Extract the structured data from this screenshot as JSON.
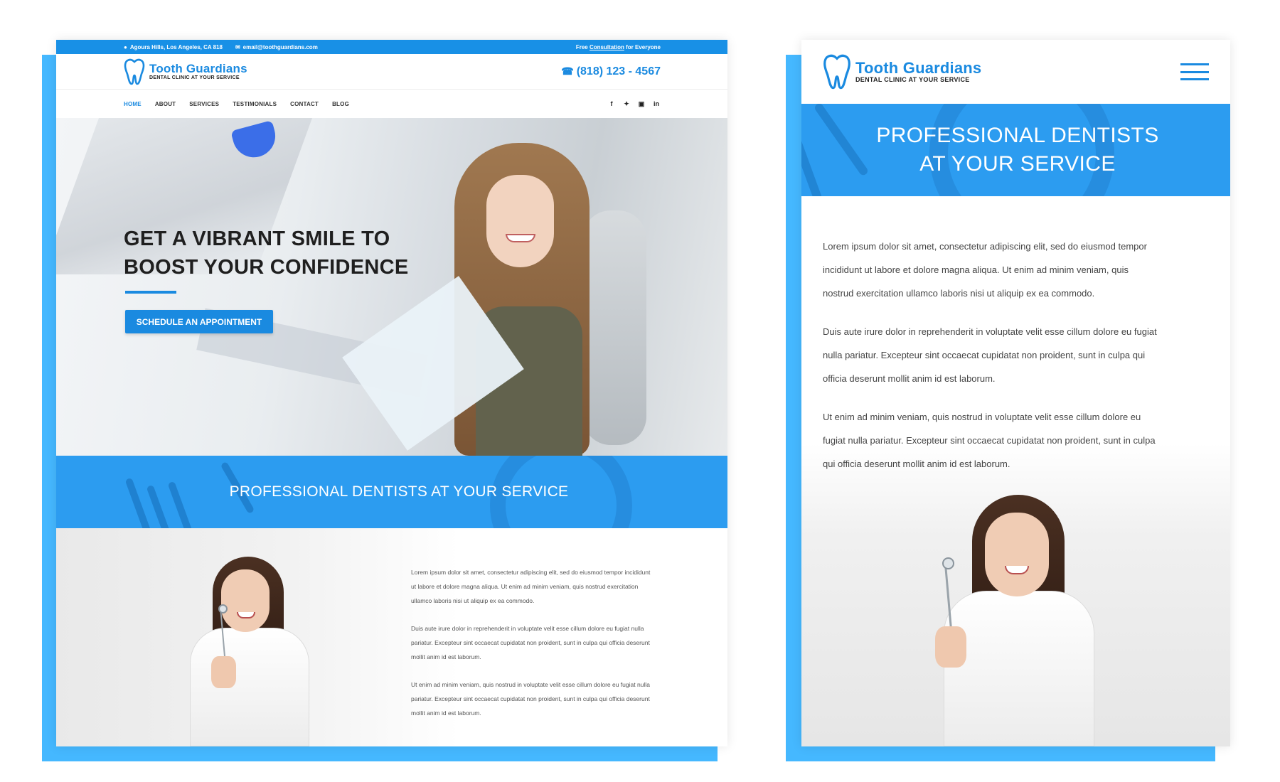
{
  "brand": {
    "name": "Tooth Guardians",
    "tagline": "DENTAL CLINIC AT YOUR SERVICE",
    "accent": "#1a8ae0",
    "frame_color": "#45b8ff"
  },
  "desktop": {
    "topbar": {
      "location_icon": "map-pin-icon",
      "location": "Agoura Hills, Los Angeles, CA 818",
      "email_icon": "envelope-icon",
      "email": "email@toothguardians.com",
      "right_prefix": "Free",
      "right_link": "Consultation",
      "right_suffix": "for Everyone"
    },
    "phone": "(818) 123 - 4567",
    "nav": [
      "HOME",
      "ABOUT",
      "SERVICES",
      "TESTIMONIALS",
      "CONTACT",
      "BLOG"
    ],
    "social": [
      "facebook-icon",
      "twitter-icon",
      "instagram-icon",
      "linkedin-icon"
    ],
    "hero": {
      "title_line1": "GET A VIBRANT SMILE TO",
      "title_line2": "BOOST YOUR CONFIDENCE",
      "button": "SCHEDULE AN APPOINTMENT"
    },
    "band_title": "PROFESSIONAL DENTISTS AT YOUR SERVICE",
    "paragraphs": [
      "Lorem ipsum dolor sit amet, consectetur adipiscing elit, sed do eiusmod tempor incididunt ut labore et dolore magna aliqua. Ut enim ad minim veniam, quis nostrud exercitation ullamco laboris nisi ut aliquip ex ea commodo.",
      "Duis aute irure dolor in reprehenderit in voluptate velit esse cillum dolore eu fugiat nulla pariatur. Excepteur sint occaecat cupidatat non proident, sunt in culpa qui officia deserunt mollit anim id est laborum.",
      "Ut enim ad minim veniam, quis nostrud in voluptate velit esse cillum dolore eu fugiat nulla pariatur. Excepteur sint occaecat cupidatat non proident, sunt in culpa qui officia deserunt mollit anim id est laborum."
    ]
  },
  "mobile": {
    "menu_icon": "hamburger-menu-icon",
    "band_title_line1": "PROFESSIONAL DENTISTS",
    "band_title_line2": "AT YOUR SERVICE",
    "paragraphs": [
      "Lorem ipsum dolor sit amet, consectetur adipiscing elit, sed do eiusmod tempor incididunt ut labore et dolore magna aliqua. Ut enim ad minim veniam, quis nostrud exercitation ullamco laboris nisi ut aliquip ex ea commodo.",
      "Duis aute irure dolor in reprehenderit in voluptate velit esse cillum dolore eu fugiat nulla pariatur. Excepteur sint occaecat cupidatat non proident, sunt in culpa qui officia deserunt mollit anim id est laborum.",
      "Ut enim ad minim veniam, quis nostrud in voluptate velit esse cillum dolore eu fugiat nulla pariatur. Excepteur sint occaecat cupidatat non proident, sunt in culpa qui officia deserunt mollit anim id est laborum."
    ]
  }
}
